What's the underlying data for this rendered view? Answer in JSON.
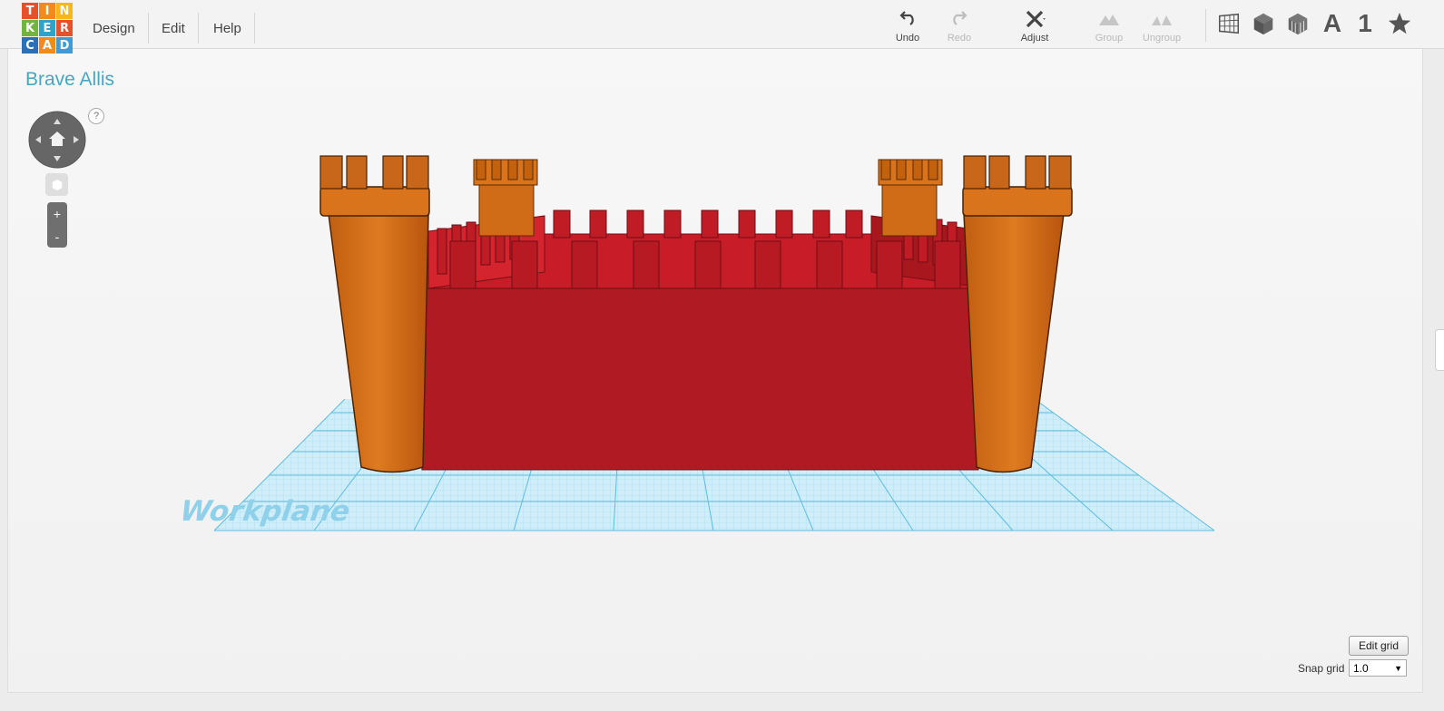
{
  "logo": {
    "letters": [
      "T",
      "I",
      "N",
      "K",
      "E",
      "R",
      "C",
      "A",
      "D"
    ],
    "colors": [
      "#e8502a",
      "#f28b1b",
      "#f6b719",
      "#71b43e",
      "#2fa2c9",
      "#e8502a",
      "#2d6fb4",
      "#f28b1b",
      "#3e9bd5"
    ]
  },
  "menu": {
    "items": [
      "Design",
      "Edit",
      "Help"
    ]
  },
  "toolbar": {
    "undo": "Undo",
    "redo": "Redo",
    "adjust": "Adjust",
    "group": "Group",
    "ungroup": "Ungroup",
    "text_icon_label": "A",
    "number_icon_label": "1"
  },
  "design": {
    "title": "Brave Allis"
  },
  "nav": {
    "help": "?",
    "zoom_in": "+",
    "zoom_out": "-"
  },
  "workplane": {
    "label": "Workplane"
  },
  "grid": {
    "edit_label": "Edit grid",
    "snap_label": "Snap grid",
    "snap_value": "1.0"
  },
  "colors": {
    "accent": "#47a7c3",
    "wall": "#b01b23",
    "tower": "#d9711a",
    "workplane": "#bfe6f5"
  },
  "icons": [
    "undo-icon",
    "redo-icon",
    "adjust-icon",
    "group-icon",
    "ungroup-icon",
    "workplane-icon",
    "box-icon",
    "wireframe-box-icon",
    "text-icon",
    "number-icon",
    "star-icon",
    "home-icon"
  ]
}
